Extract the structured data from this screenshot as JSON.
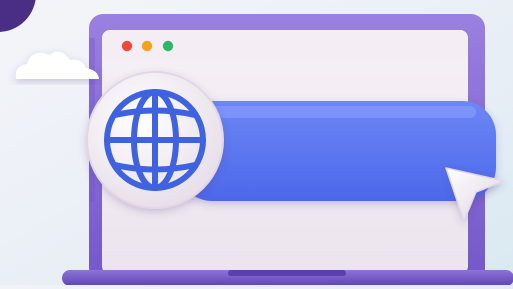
{
  "illustration": {
    "window_controls": [
      {
        "name": "close",
        "color": "#f0483e"
      },
      {
        "name": "minimize",
        "color": "#f6a21b"
      },
      {
        "name": "maximize",
        "color": "#2eb66b"
      }
    ],
    "icons": [
      "globe-icon",
      "cursor-pointer-icon",
      "cloud-icon"
    ],
    "colors": {
      "frame": "#8b6fd6",
      "frame_dark": "#6a50c0",
      "screen": "#f1ebf2",
      "search_bar": "#5c78f0",
      "globe": "#3f62e0",
      "corner_circle": "#4a2e86",
      "background": "#eef2f8"
    }
  }
}
